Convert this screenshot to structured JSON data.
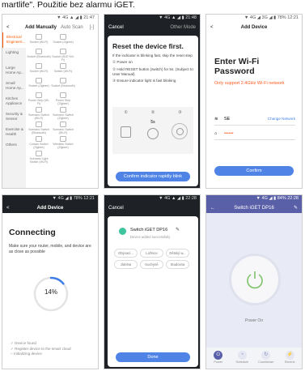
{
  "intro_text": "martlife\". Použitie bez alarmu iGET.",
  "shot1": {
    "status": "▼ 4G ▲ ◢ ▮  21:47",
    "back": "<",
    "title": "Add Manually",
    "scan": "Auto Scan",
    "scan_icon": "[-]",
    "categories": [
      "Electrical Engineeri...",
      "Lighting",
      "Large Home Ap...",
      "Small Home Ap...",
      "Kitchen Appliance",
      "Security & Sensor",
      "Exercise & Health",
      "Others"
    ],
    "devices": [
      "Socket (Wi-Fi)",
      "Socket (Zigbee)",
      "Socket (Bluetooth)",
      "Socket (BLE+Wi-Fi)",
      "Socket (Wi-Fi)",
      "Switch (Wi-Fi)",
      "Socket (Zigbee)",
      "Socket (Bluetooth)",
      "Power Strip (Wi-Fi)",
      "Power Strip (Zigbee)",
      "Scenario Switch (Wi-Fi)",
      "Scenario Switch (Zigbee)",
      "Scenario Switch (Bluetooth)",
      "Scenario Switch (Wi-Fi)",
      "Curtain Switch (Zigbee)",
      "Wireless Switch (Zigbee)",
      "Scenario Light Switch (Wi-Fi)"
    ]
  },
  "shot2": {
    "status": "▼ 4G ▲ ◢ ▮  21:48",
    "cancel": "Cancel",
    "mode": "Other Mode",
    "heading": "Reset the device first.",
    "lines": [
      "If the indicator is blinking fast, skip the reset step",
      "① Power on",
      "② Hold RESET button (switch) for 5s. (Subject to User Manual)",
      "③ Ensure indicator light is fast blinking"
    ],
    "panel": [
      "①",
      "②",
      "③",
      "5s"
    ],
    "button": "Confirm indicator rapidly blink"
  },
  "shot3": {
    "status": "▼ 4G ◢ 3G ◢ ▮ 78% 12:21",
    "back": "<",
    "title": "Add Device",
    "heading": "Enter Wi-Fi Password",
    "warning": "Only support 2.4GHz Wi-Fi network",
    "ssid": "SE",
    "change": "Change Network",
    "password": "••••••",
    "button": "Confirm",
    "colors": {
      "orange": "#ff5a1f",
      "accent": "#3f7ee8"
    }
  },
  "shot4": {
    "status": "▼ 4G ◢ ▮ 78% 12:21",
    "back": "<",
    "title": "Add Device",
    "heading": "Connecting",
    "desc": "Make sure your router, mobile, and device are as close as possible",
    "percent": "14%",
    "steps": [
      "✓ Device found",
      "✓ Register device to the smart cloud",
      "○ Initializing device"
    ],
    "progress": 0.14
  },
  "shot5": {
    "status": "▼ 4G ▲ ◢ ▮  22:28",
    "cancel": "Cancel",
    "device_name": "Switch iGET DP16",
    "edit_icon": "✎",
    "added_text": "Device added successfully",
    "rooms": [
      "Obývací...",
      "Ložnice",
      "Dětský w...",
      "Jídelna",
      "Kuchyně",
      "Studovna"
    ],
    "done": "Done"
  },
  "shot6": {
    "status": "▼ 4G ◢ ▮ 84% 22:28",
    "back": "←",
    "title": "Switch iGET DP16",
    "edit": "✎",
    "power_label": "Power On",
    "tabs": [
      "Power",
      "Schedule",
      "Countdown",
      "Electric"
    ],
    "tab_icons": [
      "⏻",
      "◔",
      "↻",
      "⚡"
    ]
  }
}
